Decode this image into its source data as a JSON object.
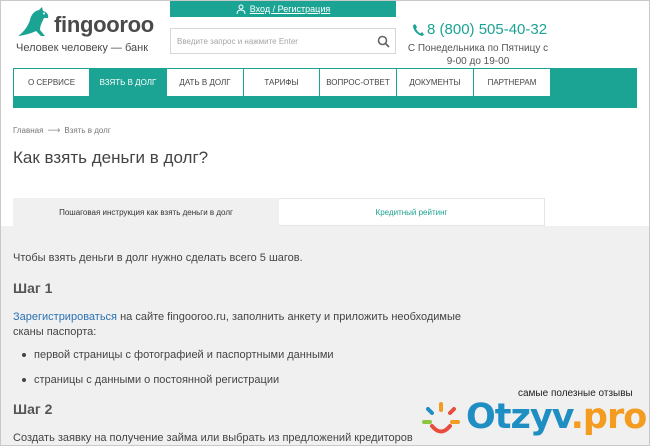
{
  "header": {
    "logo_text": "fingooroo",
    "tagline": "Человек человеку — банк",
    "login_label": "Вход / Регистрация",
    "search_placeholder": "Введите запрос и нажмите Enter",
    "phone": "8 (800) 505-40-32",
    "hours": "С Понедельника по Пятницу с 9-00 до 19-00",
    "brand_color": "#1ba393"
  },
  "nav": {
    "items": [
      {
        "label": "О СЕРВИСЕ",
        "active": false
      },
      {
        "label": "ВЗЯТЬ В ДОЛГ",
        "active": true
      },
      {
        "label": "ДАТЬ В ДОЛГ",
        "active": false
      },
      {
        "label": "ТАРИФЫ",
        "active": false
      },
      {
        "label": "ВОПРОС-ОТВЕТ",
        "active": false
      },
      {
        "label": "ДОКУМЕНТЫ",
        "active": false
      },
      {
        "label": "ПАРТНЕРАМ",
        "active": false
      }
    ]
  },
  "breadcrumb": {
    "home": "Главная",
    "current": "Взять в долг"
  },
  "page": {
    "title": "Как взять деньги в долг?",
    "tabs": [
      {
        "label": "Пошаговая инструкция как взять деньги в долг",
        "active": true
      },
      {
        "label": "Кредитный рейтинг",
        "active": false
      }
    ],
    "intro": "Чтобы взять деньги в долг нужно сделать всего 5 шагов.",
    "step1_title": "Шаг 1",
    "step1_link": "Зарегистрироваться",
    "step1_text": " на сайте fingooroo.ru, заполнить анкету и приложить необходимые сканы паспорта:",
    "bullets": [
      "первой страницы с фотографией и паспортными данными",
      "страницы с данными о постоянной регистрации"
    ],
    "step2_title": "Шаг 2",
    "step2_text": "Создать заявку на получение займа или выбрать из предложений кредиторов"
  },
  "watermark": {
    "caption": "самые полезные отзывы",
    "brand_main": "Otzyv",
    "brand_tld": ".pro"
  }
}
